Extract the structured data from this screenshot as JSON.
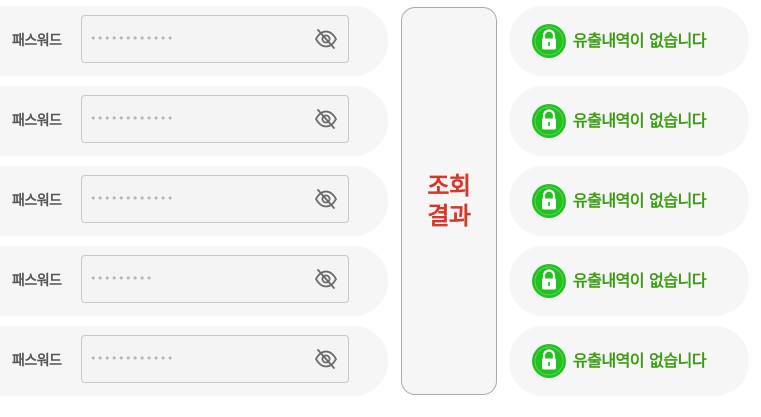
{
  "colors": {
    "row_background": "#f6f6f6",
    "input_background": "#f4f4f4",
    "input_border": "#c9c9c9",
    "result_text": "#d5382a",
    "status_text": "#3d9d12",
    "lock_badge": "#1fc21f"
  },
  "password_rows": [
    {
      "label": "패스워드",
      "masked_value": "••••••••••••",
      "icon": "eye-off-icon"
    },
    {
      "label": "패스워드",
      "masked_value": "••••••••••••",
      "icon": "eye-off-icon"
    },
    {
      "label": "패스워드",
      "masked_value": "••••••••••••",
      "icon": "eye-off-icon"
    },
    {
      "label": "패스워드",
      "masked_value": "•••••••••",
      "icon": "eye-off-icon"
    },
    {
      "label": "패스워드",
      "masked_value": "••••••••••••",
      "icon": "eye-off-icon"
    }
  ],
  "result_box": {
    "line1": "조회",
    "line2": "결과"
  },
  "status_rows": [
    {
      "text": "유출내역이 없습니다",
      "icon": "lock-icon"
    },
    {
      "text": "유출내역이 없습니다",
      "icon": "lock-icon"
    },
    {
      "text": "유출내역이 없습니다",
      "icon": "lock-icon"
    },
    {
      "text": "유출내역이 없습니다",
      "icon": "lock-icon"
    },
    {
      "text": "유출내역이 없습니다",
      "icon": "lock-icon"
    }
  ]
}
